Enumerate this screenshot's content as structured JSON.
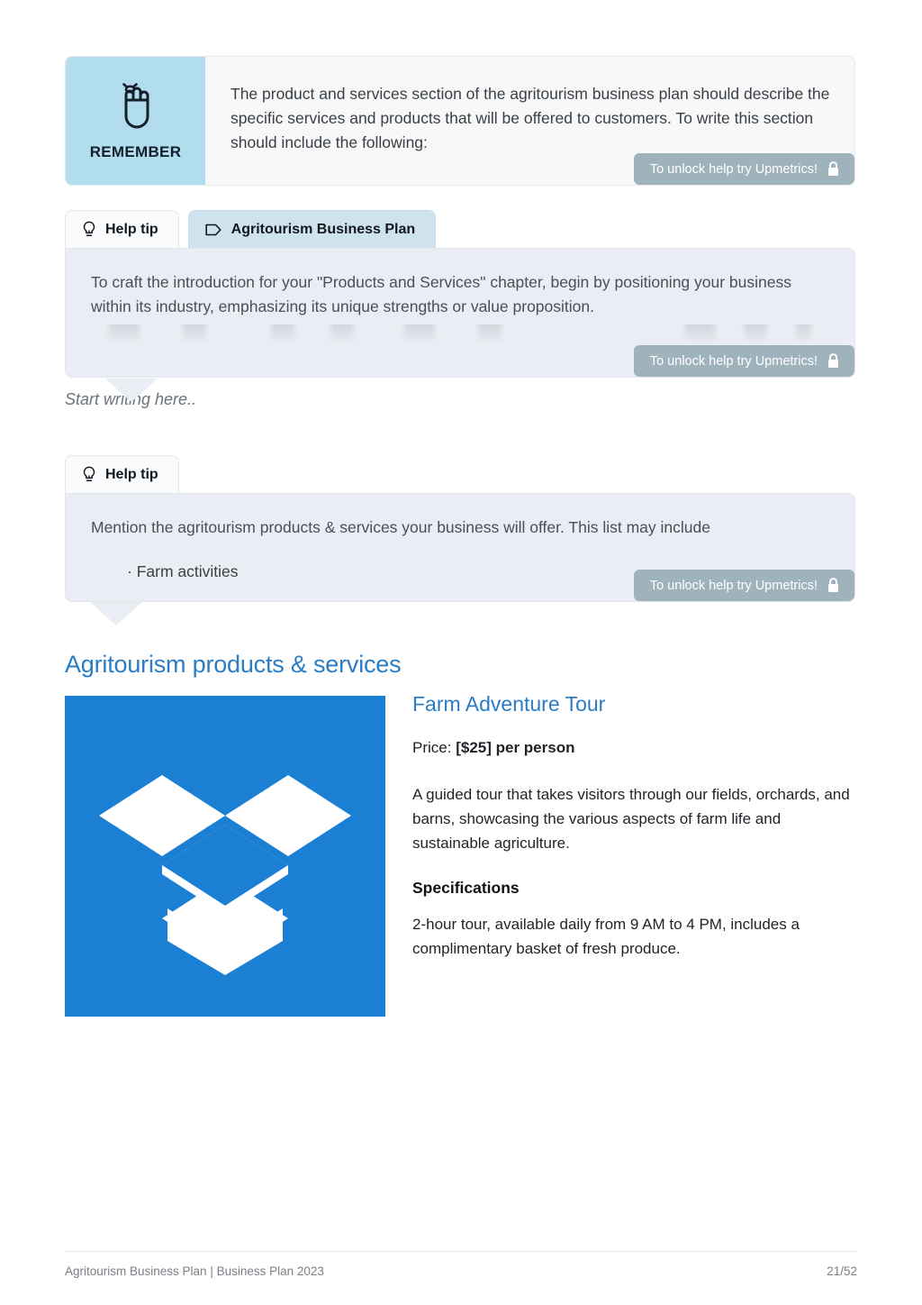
{
  "remember": {
    "icon": "hand-string-reminder-icon",
    "label": "REMEMBER",
    "text": "The product and services section of the agritourism business plan should describe the specific services and products that will be offered to customers. To write this section should include the following:",
    "badge": {
      "text": "To unlock help try Upmetrics!",
      "icon": "lock-icon"
    },
    "bg_color": "#b2ddef"
  },
  "tip_one": {
    "tabs": [
      {
        "label": "Help tip",
        "icon": "lightbulb-icon",
        "active": false
      },
      {
        "label": "Agritourism Business Plan",
        "icon": "tag-icon",
        "active": true
      }
    ],
    "text": "To craft the introduction for your \"Products and Services\" chapter, begin by positioning your business within its industry, emphasizing its unique strengths or value proposition.",
    "badge": {
      "text": "To unlock help try Upmetrics!",
      "icon": "lock-icon"
    }
  },
  "editor_placeholder": "Start writing here..",
  "tip_two": {
    "tabs": [
      {
        "label": "Help tip",
        "icon": "lightbulb-icon",
        "active": false
      }
    ],
    "text": "Mention the agritourism products & services your business will offer. This list may include",
    "bullets": [
      "· Farm activities"
    ],
    "badge": {
      "text": "To unlock help try Upmetrics!",
      "icon": "lock-icon"
    }
  },
  "section": {
    "heading": "Agritourism products & services"
  },
  "product": {
    "image": {
      "name": "dropbox-logo",
      "bg_color": "#1b7fd4"
    },
    "title": "Farm Adventure Tour",
    "price_label": "Price:",
    "price_value": "[$25] per person",
    "description": "A guided tour that takes visitors through our fields, orchards, and barns, showcasing the various aspects of farm life and sustainable agriculture.",
    "spec_heading": "Specifications",
    "spec_text": "2-hour tour, available daily from 9 AM to 4 PM, includes a complimentary basket of fresh produce."
  },
  "footer": {
    "left": "Agritourism Business Plan | Business Plan 2023",
    "right": "21/52"
  },
  "colors": {
    "accent_blue": "#2a7dc4",
    "remember_blue": "#b2ddef",
    "tab_active_blue": "#cfe3ef",
    "tip_body_gray": "#eaedf3",
    "badge_gray": "#9fb3bd"
  }
}
